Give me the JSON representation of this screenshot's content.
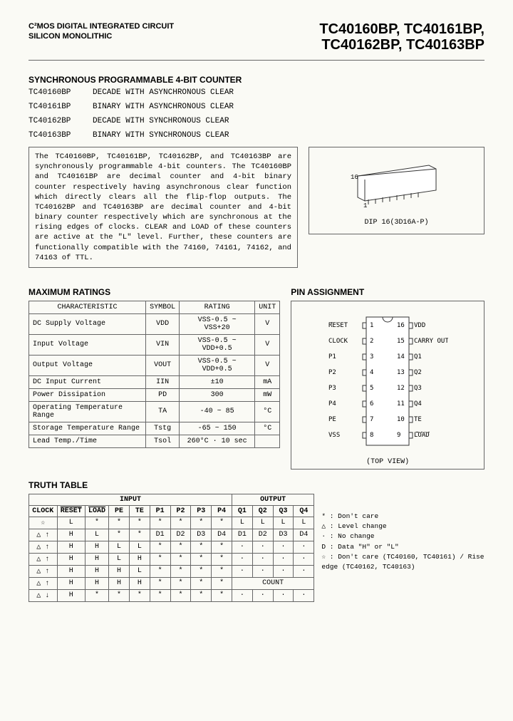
{
  "header": {
    "left_line1": "C²MOS DIGITAL INTEGRATED CIRCUIT",
    "left_line2": "SILICON MONOLITHIC",
    "right_line1": "TC40160BP, TC40161BP,",
    "right_line2": "TC40162BP, TC40163BP"
  },
  "intro": {
    "title": "SYNCHRONOUS PROGRAMMABLE 4-BIT COUNTER",
    "parts": [
      {
        "pn": "TC40160BP",
        "desc": "DECADE WITH ASYNCHRONOUS CLEAR"
      },
      {
        "pn": "TC40161BP",
        "desc": "BINARY WITH ASYNCHRONOUS CLEAR"
      },
      {
        "pn": "TC40162BP",
        "desc": "DECADE WITH SYNCHRONOUS CLEAR"
      },
      {
        "pn": "TC40163BP",
        "desc": "BINARY WITH SYNCHRONOUS CLEAR"
      }
    ],
    "description": "The TC40160BP, TC40161BP, TC40162BP, and TC40163BP are synchronously programmable 4-bit counters. The TC40160BP and TC40161BP are decimal counter and 4-bit binary counter respectively having asynchronous clear function which directly clears all the flip-flop outputs. The TC40162BP and TC40163BP are decimal counter and 4-bit binary counter respectively which are synchronous at the rising edges of clocks. CLEAR and LOAD of these counters are active at the \"L\" level. Further, these counters are functionally compatible with the 74160, 74161, 74162, and 74163 of TTL.",
    "package": "DIP 16(3D16A-P)",
    "pin16": "16",
    "pin1": "1"
  },
  "ratings": {
    "title": "MAXIMUM RATINGS",
    "headers": [
      "CHARACTERISTIC",
      "SYMBOL",
      "RATING",
      "UNIT"
    ],
    "rows": [
      [
        "DC Supply Voltage",
        "VDD",
        "VSS-0.5 ~ VSS+20",
        "V"
      ],
      [
        "Input Voltage",
        "VIN",
        "VSS-0.5 ~ VDD+0.5",
        "V"
      ],
      [
        "Output Voltage",
        "VOUT",
        "VSS-0.5 ~ VDD+0.5",
        "V"
      ],
      [
        "DC Input Current",
        "IIN",
        "±10",
        "mA"
      ],
      [
        "Power Dissipation",
        "PD",
        "300",
        "mW"
      ],
      [
        "Operating Temperature Range",
        "TA",
        "-40 ~ 85",
        "°C"
      ],
      [
        "Storage Temperature Range",
        "Tstg",
        "-65 ~ 150",
        "°C"
      ],
      [
        "Lead Temp./Time",
        "Tsol",
        "260°C · 10 sec",
        ""
      ]
    ]
  },
  "pins": {
    "title": "PIN ASSIGNMENT",
    "caption": "(TOP VIEW)",
    "left": [
      "RESET",
      "CLOCK",
      "P1",
      "P2",
      "P3",
      "P4",
      "PE",
      "VSS"
    ],
    "right": [
      "VDD",
      "CARRY OUT",
      "Q1",
      "Q2",
      "Q3",
      "Q4",
      "TE",
      "LOAD"
    ],
    "left_nums": [
      "1",
      "2",
      "3",
      "4",
      "5",
      "6",
      "7",
      "8"
    ],
    "right_nums": [
      "16",
      "15",
      "14",
      "13",
      "12",
      "11",
      "10",
      "9"
    ]
  },
  "truth": {
    "title": "TRUTH TABLE",
    "input_label": "INPUT",
    "output_label": "OUTPUT",
    "headers": [
      "CLOCK",
      "RESET",
      "LOAD",
      "PE",
      "TE",
      "P1",
      "P2",
      "P3",
      "P4",
      "Q1",
      "Q2",
      "Q3",
      "Q4"
    ],
    "rows": [
      [
        "☆",
        "L",
        "*",
        "*",
        "*",
        "*",
        "*",
        "*",
        "*",
        "L",
        "L",
        "L",
        "L"
      ],
      [
        "△ ↑",
        "H",
        "L",
        "*",
        "*",
        "D1",
        "D2",
        "D3",
        "D4",
        "D1",
        "D2",
        "D3",
        "D4"
      ],
      [
        "△ ↑",
        "H",
        "H",
        "L",
        "L",
        "*",
        "*",
        "*",
        "*",
        "·",
        "·",
        "·",
        "·"
      ],
      [
        "△ ↑",
        "H",
        "H",
        "L",
        "H",
        "*",
        "*",
        "*",
        "*",
        "·",
        "·",
        "·",
        "·"
      ],
      [
        "△ ↑",
        "H",
        "H",
        "H",
        "L",
        "*",
        "*",
        "*",
        "*",
        "·",
        "·",
        "·",
        "·"
      ],
      [
        "△ ↑",
        "H",
        "H",
        "H",
        "H",
        "*",
        "*",
        "*",
        "*",
        "COUNT",
        "",
        "",
        ""
      ],
      [
        "△ ↓",
        "H",
        "*",
        "*",
        "*",
        "*",
        "*",
        "*",
        "*",
        "·",
        "·",
        "·",
        "·"
      ]
    ],
    "legend": [
      "* : Don't care",
      "△ : Level change",
      "· : No change",
      "D : Data \"H\" or \"L\"",
      "☆ : Don't care (TC40160, TC40161) / Rise edge (TC40162, TC40163)"
    ]
  }
}
